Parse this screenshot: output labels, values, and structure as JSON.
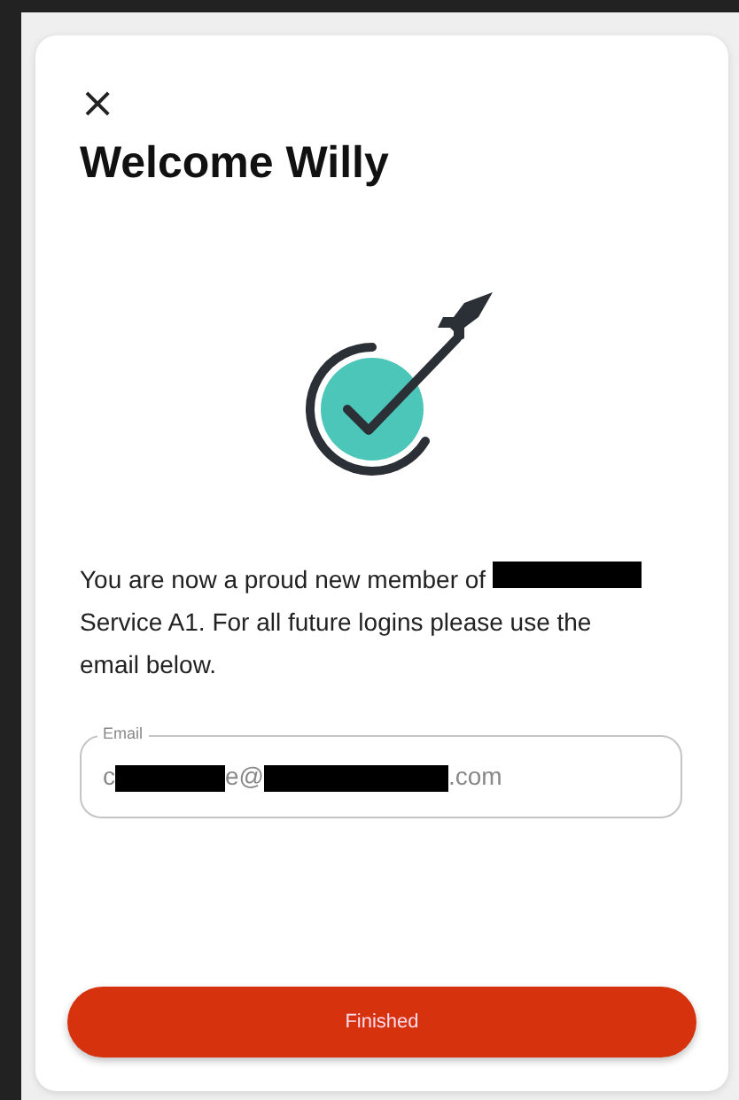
{
  "dialog": {
    "close": "×",
    "title": "Welcome Willy",
    "message": [
      {
        "kind": "text",
        "text": "You are now a proud new member of "
      },
      {
        "kind": "redacted"
      },
      {
        "kind": "text",
        "text": " Service A1. For all future logins please use the email below."
      }
    ],
    "email_field": {
      "label": "Email",
      "value": [
        {
          "kind": "text",
          "text": "c"
        },
        {
          "kind": "redacted"
        },
        {
          "kind": "text",
          "text": "e@"
        },
        {
          "kind": "redacted"
        },
        {
          "kind": "text",
          "text": ".com"
        }
      ]
    },
    "button": "Finished"
  }
}
